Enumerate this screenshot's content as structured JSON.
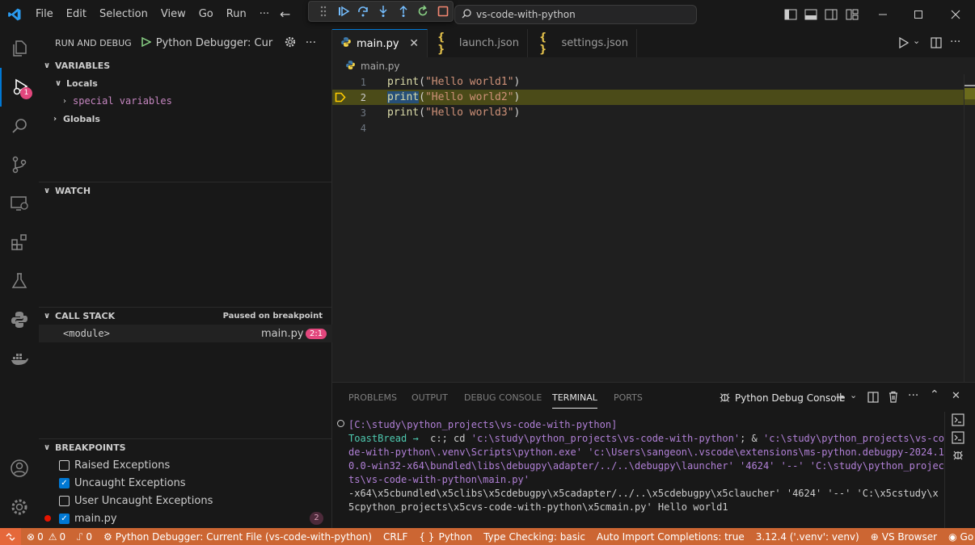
{
  "menu": [
    "File",
    "Edit",
    "Selection",
    "View",
    "Go",
    "Run",
    "···"
  ],
  "command_center": {
    "text": "vs-code-with-python"
  },
  "activity": {
    "debug_badge": "1"
  },
  "sidebar": {
    "header": "RUN AND DEBUG",
    "config": "Python Debugger: Curr",
    "variables_title": "VARIABLES",
    "locals_label": "Locals",
    "special_vars": "special variables",
    "globals_label": "Globals",
    "watch_title": "WATCH",
    "callstack_title": "CALL STACK",
    "callstack_status": "Paused on breakpoint",
    "frame": {
      "name": "<module>",
      "file": "main.py",
      "pos": "2:1"
    },
    "breakpoints_title": "BREAKPOINTS",
    "breakpoints": [
      {
        "label": "Raised Exceptions",
        "checked": false
      },
      {
        "label": "Uncaught Exceptions",
        "checked": true
      },
      {
        "label": "User Uncaught Exceptions",
        "checked": false
      },
      {
        "label": "main.py",
        "checked": true,
        "count": "2"
      }
    ]
  },
  "editor": {
    "tabs": [
      {
        "label": "main.py"
      },
      {
        "label": "launch.json"
      },
      {
        "label": "settings.json"
      }
    ],
    "breadcrumb": "main.py",
    "lines": [
      {
        "no": "1",
        "fn": "print",
        "open": "(",
        "str": "\"Hello world1\"",
        "close": ")"
      },
      {
        "no": "2",
        "fn": "print",
        "open": "(",
        "str": "\"Hello world2\"",
        "close": ")"
      },
      {
        "no": "3",
        "fn": "print",
        "open": "(",
        "str": "\"Hello world3\"",
        "close": ")"
      },
      {
        "no": "4",
        "fn": "",
        "open": "",
        "str": "",
        "close": ""
      }
    ]
  },
  "panel": {
    "tabs": [
      "PROBLEMS",
      "OUTPUT",
      "DEBUG CONSOLE",
      "TERMINAL",
      "PORTS"
    ],
    "terminal_name": "Python Debug Console",
    "prompt_path": "[C:\\study\\python_projects\\vs-code-with-python]",
    "prompt_user": "ToastBread →",
    "cmd_a": "  c:; cd ",
    "cmd_b": "'c:\\study\\python_projects\\vs-code-with-python'",
    "cmd_c": "; & ",
    "cmd_d": "'c:\\study\\python_projects\\vs-co",
    "line3": "de-with-python\\.venv\\Scripts\\python.exe' 'c:\\Users\\sangeon\\.vscode\\extensions\\ms-python.debugpy-2024.1",
    "line4": "0.0-win32-x64\\bundled\\libs\\debugpy\\adapter/../..\\debugpy\\launcher' '4624' '--' 'C:\\study\\python_projec",
    "line5": "ts\\vs-code-with-python\\main.py'",
    "line6": "-x64\\x5cbundled\\x5clibs\\x5cdebugpy\\x5cadapter/../..\\x5cdebugpy\\x5claucher' '4624' '--' 'C:\\x5cstudy\\x",
    "line7": "5cpython_projects\\x5cvs-code-with-python\\x5cmain.py' Hello world1"
  },
  "status": {
    "errors": "0",
    "warnings": "0",
    "ports": "0",
    "debug": "Python Debugger: Current File (vs-code-with-python)",
    "eol": "CRLF",
    "lang": "Python",
    "type_check": "Type Checking: basic",
    "auto_import": "Auto Import Completions: true",
    "interp": "3.12.4 ('.venv': venv)",
    "browser": "VS Browser",
    "golive": "Go Live"
  }
}
